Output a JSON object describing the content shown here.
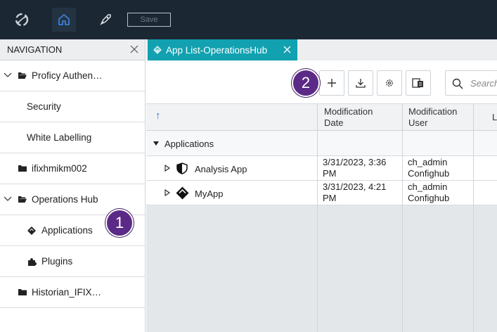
{
  "topbar": {
    "save_label": "Save",
    "icons": [
      "logo-icon",
      "home-icon",
      "rocket-icon"
    ],
    "bg_color": "#1b2733",
    "home_color": "#3a7fd6"
  },
  "nav": {
    "title": "NAVIGATION",
    "items": [
      {
        "label": "Proficy Authen…",
        "level": 0,
        "expanded": true,
        "icon": "folder-open-icon"
      },
      {
        "label": "Security",
        "level": 1
      },
      {
        "label": "White Labelling",
        "level": 1
      },
      {
        "label": "ifixhmikm002",
        "level": 0,
        "icon": "folder-icon"
      },
      {
        "label": "Operations Hub",
        "level": 0,
        "expanded": true,
        "icon": "folder-open-icon"
      },
      {
        "label": "Applications",
        "level": 1,
        "icon": "applications-icon"
      },
      {
        "label": "Plugins",
        "level": 1,
        "icon": "puzzle-icon"
      },
      {
        "label": "Historian_IFIX…",
        "level": 0,
        "icon": "folder-icon"
      }
    ]
  },
  "tab": {
    "label": "App List-OperationsHub",
    "color": "#11a1b0"
  },
  "toolbar": {
    "search_placeholder": "Search"
  },
  "callouts": {
    "one": "1",
    "two": "2",
    "color": "#5b2a86"
  },
  "grid": {
    "sort_indicator": "↑",
    "columns": [
      {
        "line1": "Modification",
        "line2": "Date"
      },
      {
        "line1": "Modification",
        "line2": "User"
      },
      {
        "line1": "L",
        "line2": ""
      }
    ],
    "group_label": "Applications",
    "rows": [
      {
        "name": "Analysis App",
        "date1": "3/31/2023, 3:36",
        "date2": "PM",
        "user1": "ch_admin",
        "user2": "Confighub"
      },
      {
        "name": "MyApp",
        "date1": "3/31/2023, 4:21",
        "date2": "PM",
        "user1": "ch_admin",
        "user2": "Confighub"
      }
    ]
  }
}
